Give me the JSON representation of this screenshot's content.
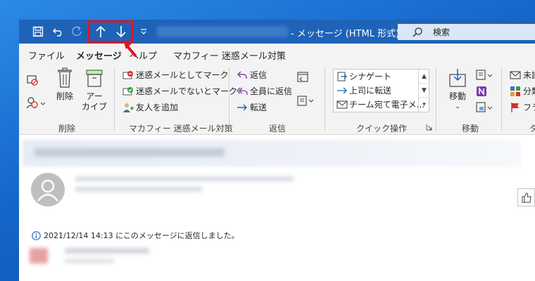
{
  "titlebar": {
    "title": "- メッセージ (HTML 形式)",
    "search_label": "検索",
    "qat": {
      "save_icon": "save-icon",
      "undo_icon": "undo-icon",
      "redo_icon": "redo-icon",
      "prev_icon": "arrow-up-icon",
      "next_icon": "arrow-down-icon",
      "customize_icon": "customize-qat-icon"
    }
  },
  "tabs": [
    "ファイル",
    "メッセージ",
    "ヘルプ",
    "マカフィー 迷惑メール対策"
  ],
  "ribbon": {
    "delete_group": {
      "label": "削除",
      "delete_button": "削除",
      "archive_line1": "アー",
      "archive_line2": "カイブ"
    },
    "mcafee_group": {
      "label": "マカフィー 迷惑メール対策",
      "mark_spam": "迷惑メールとしてマーク",
      "mark_not_spam": "迷惑メールでないとマーク",
      "add_friend": "友人を追加"
    },
    "respond_group": {
      "label": "返信",
      "reply": "返信",
      "reply_all": "全員に返信",
      "forward": "転送"
    },
    "quick_group": {
      "label": "クイック操作",
      "items": [
        "シナゲート",
        "上司に転送",
        "チーム宛て電子メ..."
      ]
    },
    "move_group": {
      "label": "移動",
      "move_button": "移動"
    },
    "tags_group": {
      "label": "タ",
      "items": [
        "未読",
        "分類",
        "フラ"
      ]
    }
  },
  "message": {
    "info_text": "2021/12/14 14:13 にこのメッセージに返信しました。"
  },
  "colors": {
    "titlebar": "#1e63b8",
    "desktop": "#1d6fcf",
    "highlight": "#e5141b"
  }
}
